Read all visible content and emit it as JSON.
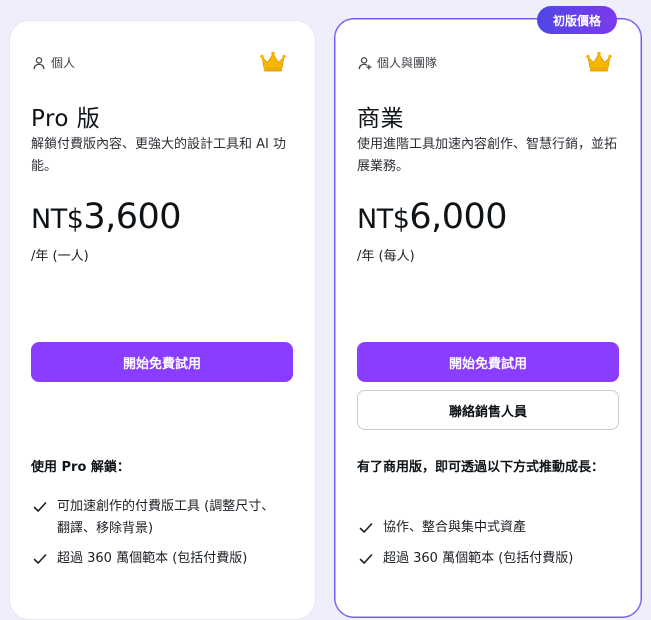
{
  "badge": {
    "label": "初版價格"
  },
  "colors": {
    "accent": "#8b3dff",
    "badge_gradient_start": "#4f46e5",
    "badge_gradient_end": "#7c3aed",
    "crown": "#f5b700"
  },
  "plans": [
    {
      "type_label": "個人",
      "type_icon": "person-icon",
      "name": "Pro 版",
      "description": "解鎖付費版內容、更強大的設計工具和 AI 功能。",
      "currency": "NT$",
      "amount": "3,600",
      "period": "/年 (一人)",
      "primary_button": "開始免費試用",
      "features_title": "使用 Pro 解鎖：",
      "features": [
        "可加速創作的付費版工具 (調整尺寸、翻譯、移除背景)",
        "超過 360 萬個範本 (包括付費版)"
      ]
    },
    {
      "type_label": "個人與團隊",
      "type_icon": "person-add-icon",
      "name": "商業",
      "description": "使用進階工具加速內容創作、智慧行銷，並拓展業務。",
      "currency": "NT$",
      "amount": "6,000",
      "period": "/年 (每人)",
      "primary_button": "開始免費試用",
      "secondary_button": "聯絡銷售人員",
      "features_title": "有了商用版，即可透過以下方式推動成長：",
      "features": [
        "協作、整合與集中式資產",
        "超過 360 萬個範本 (包括付費版)"
      ]
    }
  ]
}
